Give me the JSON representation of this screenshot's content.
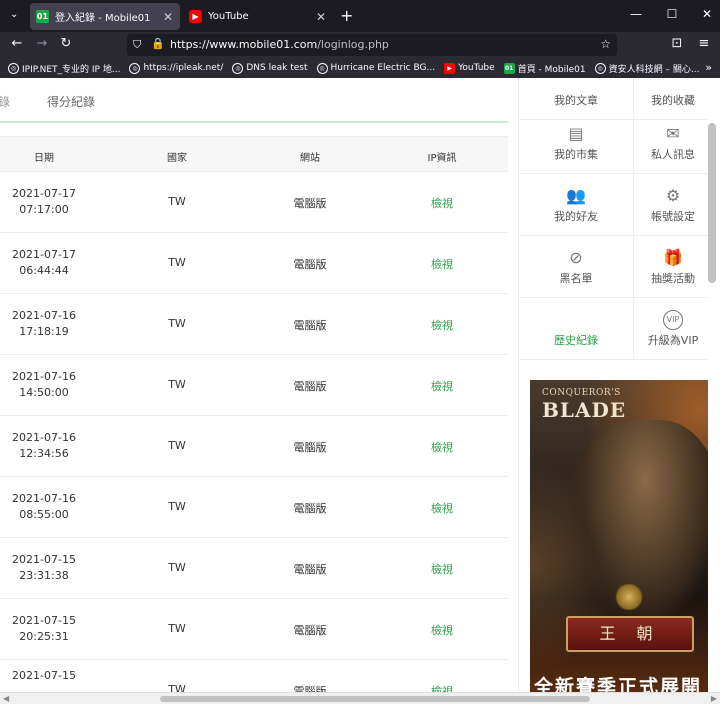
{
  "browser": {
    "tabs": [
      {
        "title": "登入紀錄 - Mobile01",
        "active": true,
        "favicon": "01"
      },
      {
        "title": "YouTube",
        "active": false,
        "favicon": "▶"
      }
    ],
    "new_tab": "+",
    "close_glyph": "✕",
    "url_host": "https://www.mobile01.com",
    "url_path": "/loginlog.php",
    "bookmarks": [
      {
        "label": "IPIP.NET_专业的 IP 地...",
        "icon": "globe-icon"
      },
      {
        "label": "https://ipleak.net/",
        "icon": "globe-icon"
      },
      {
        "label": "DNS leak test",
        "icon": "globe-icon"
      },
      {
        "label": "Hurricane Electric BG...",
        "icon": "globe-icon"
      },
      {
        "label": "YouTube",
        "icon": "youtube-icon"
      },
      {
        "label": "首頁 - Mobile01",
        "icon": "mobile01-icon"
      },
      {
        "label": "資安人科技網 – 關心...",
        "icon": "globe-icon"
      }
    ]
  },
  "page": {
    "subtabs": {
      "partial": "錄",
      "score": "得分紀錄"
    },
    "table": {
      "headers": {
        "date": "日期",
        "country": "國家",
        "site": "網站",
        "ip": "IP資訊"
      },
      "rows": [
        {
          "date": "2021-07-17",
          "time": "07:17:00",
          "country": "TW",
          "site": "電腦版",
          "ip": "檢視"
        },
        {
          "date": "2021-07-17",
          "time": "06:44:44",
          "country": "TW",
          "site": "電腦版",
          "ip": "檢視"
        },
        {
          "date": "2021-07-16",
          "time": "17:18:19",
          "country": "TW",
          "site": "電腦版",
          "ip": "檢視"
        },
        {
          "date": "2021-07-16",
          "time": "14:50:00",
          "country": "TW",
          "site": "電腦版",
          "ip": "檢視"
        },
        {
          "date": "2021-07-16",
          "time": "12:34:56",
          "country": "TW",
          "site": "電腦版",
          "ip": "檢視"
        },
        {
          "date": "2021-07-16",
          "time": "08:55:00",
          "country": "TW",
          "site": "電腦版",
          "ip": "檢視"
        },
        {
          "date": "2021-07-15",
          "time": "23:31:38",
          "country": "TW",
          "site": "電腦版",
          "ip": "檢視"
        },
        {
          "date": "2021-07-15",
          "time": "20:25:31",
          "country": "TW",
          "site": "電腦版",
          "ip": "檢視"
        },
        {
          "date": "2021-07-15",
          "time": "",
          "country": "TW",
          "site": "電腦版",
          "ip": "檢視"
        }
      ]
    },
    "sidebar": {
      "items": [
        {
          "label": "我的文章",
          "icon": "article-icon",
          "glyph": ""
        },
        {
          "label": "我的收藏",
          "icon": "bookmark-icon",
          "glyph": ""
        },
        {
          "label": "我的市集",
          "icon": "store-icon",
          "glyph": "▤"
        },
        {
          "label": "私人訊息",
          "icon": "mail-icon",
          "glyph": "✉"
        },
        {
          "label": "我的好友",
          "icon": "friends-icon",
          "glyph": "👥"
        },
        {
          "label": "帳號設定",
          "icon": "gear-icon",
          "glyph": "⚙"
        },
        {
          "label": "黑名單",
          "icon": "block-icon",
          "glyph": "⊘"
        },
        {
          "label": "抽獎活動",
          "icon": "gift-icon",
          "glyph": "🎁"
        },
        {
          "label": "歷史紀錄",
          "icon": "history-icon",
          "glyph": ""
        },
        {
          "label": "升級為VIP",
          "icon": "vip-icon",
          "glyph": "VIP"
        }
      ],
      "active_color": "#2ea04a"
    },
    "ad": {
      "brand_small": "CONQUEROR'S",
      "brand": "BLADE",
      "banner": "王 朝",
      "promo": "全新賽季正式展開"
    }
  },
  "colors": {
    "accent": "#2ea04a",
    "chrome_bg": "#1c1b22"
  }
}
